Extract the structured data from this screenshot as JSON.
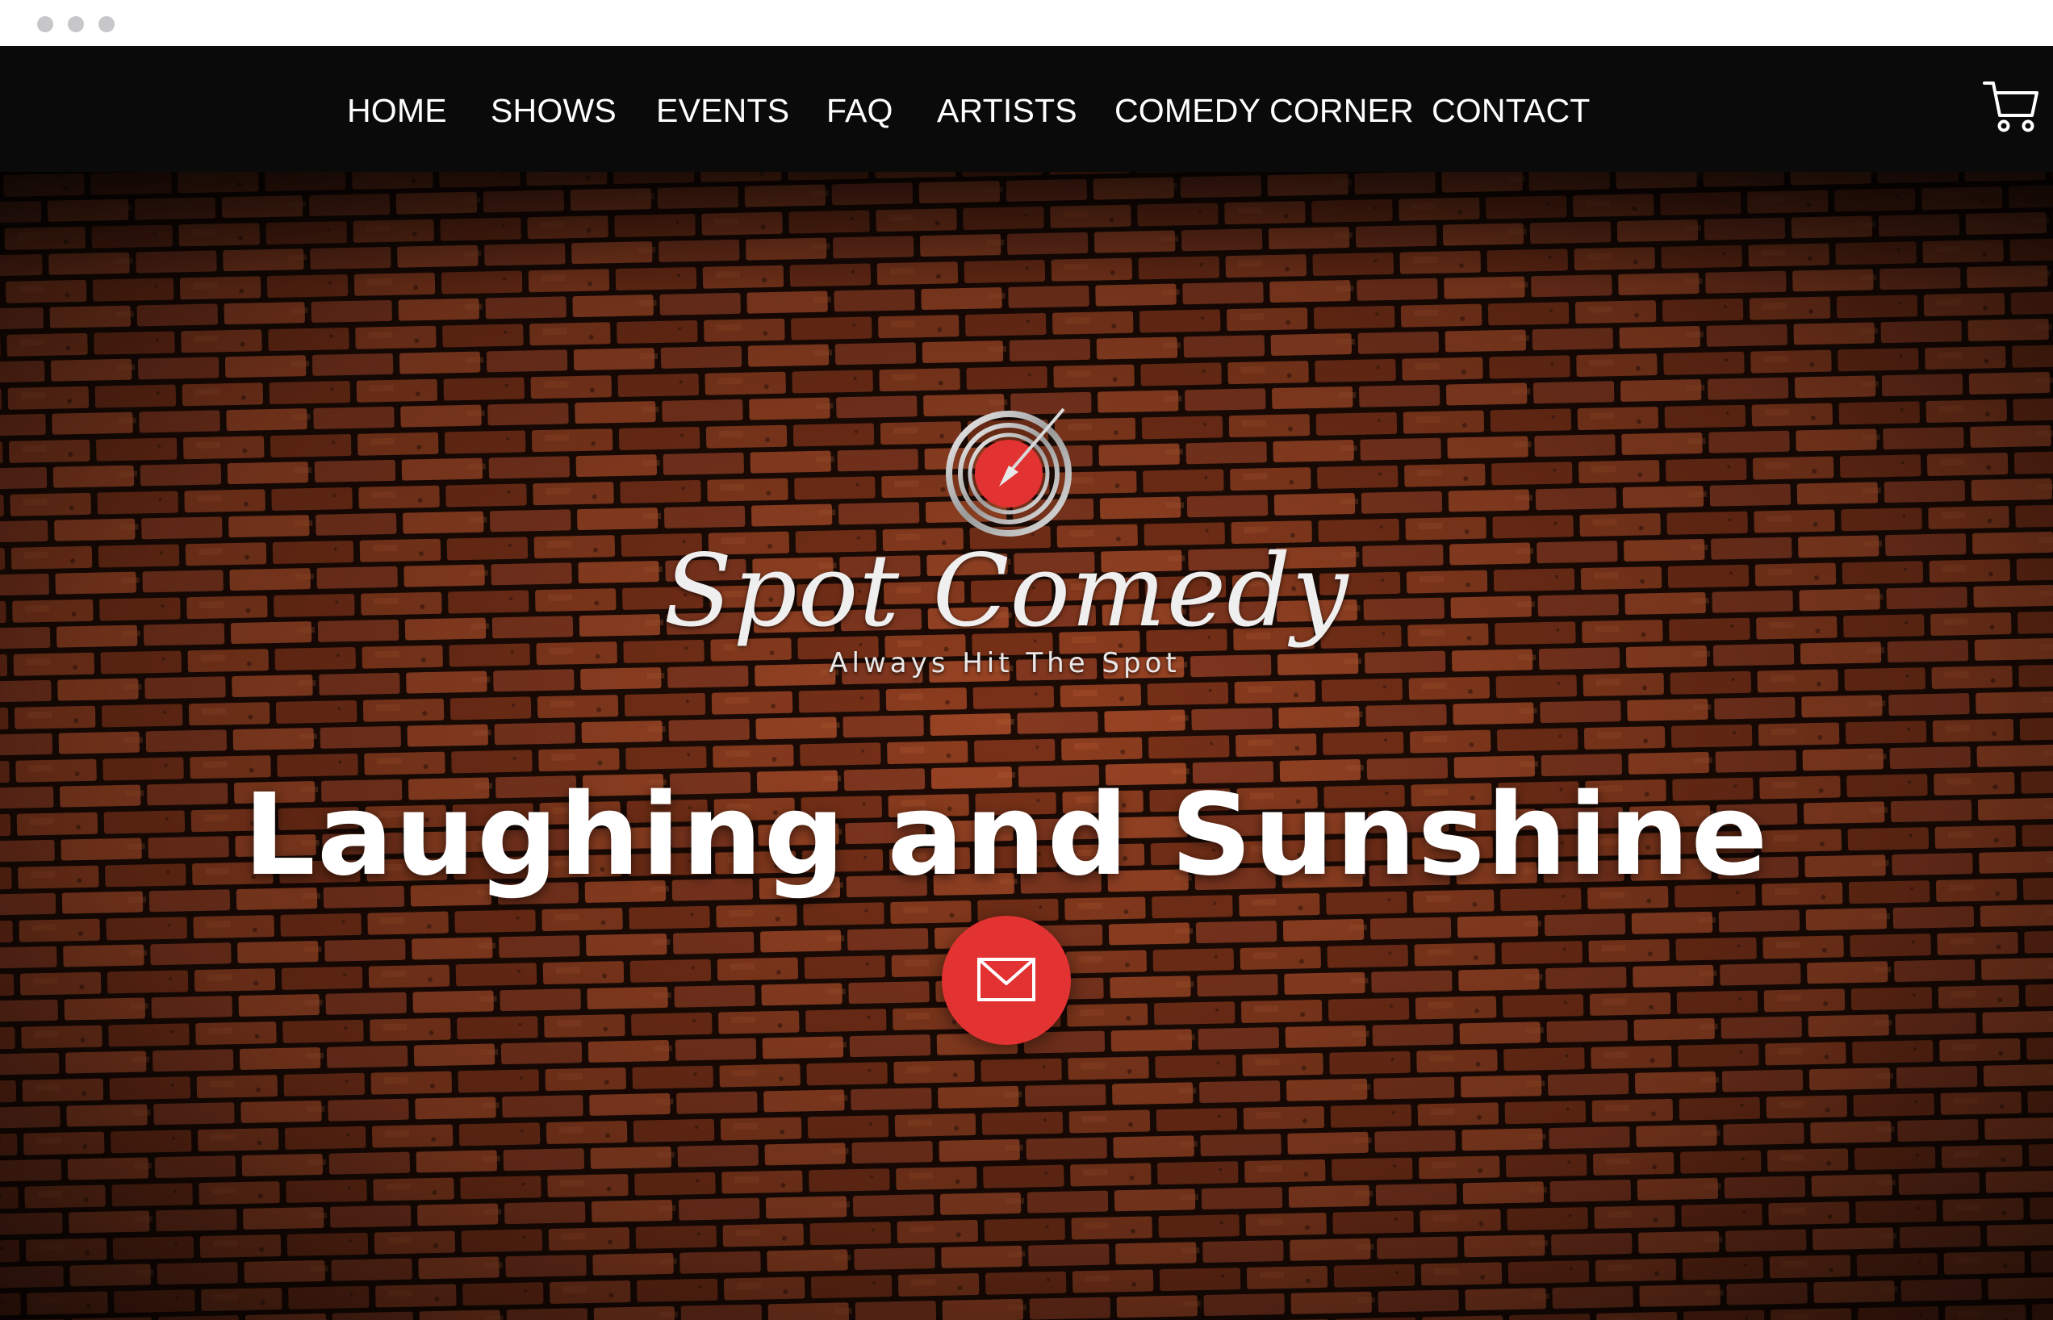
{
  "nav": {
    "items": [
      {
        "label": "HOME"
      },
      {
        "label": "SHOWS"
      },
      {
        "label": "EVENTS"
      },
      {
        "label": "FAQ"
      },
      {
        "label": "ARTISTS"
      },
      {
        "label": "COMEDY CORNER"
      },
      {
        "label": "CONTACT"
      }
    ],
    "cart_icon": "shopping-cart-icon"
  },
  "hero": {
    "logo": {
      "icon": "target-arrow-icon",
      "name": "Spot Comedy",
      "tagline": "Always Hit The Spot"
    },
    "headline": "Laughing and Sunshine",
    "mail_icon": "envelope-icon"
  },
  "colors": {
    "accent": "#e23232",
    "nav_background": "#0a0a0b",
    "brick": "#8a3a1e"
  }
}
